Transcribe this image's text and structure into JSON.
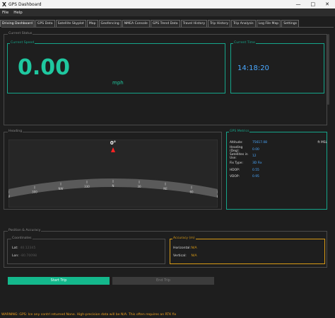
{
  "window": {
    "title": "GPS Dashboard",
    "minimize": "—",
    "maximize": "□",
    "close": "✕",
    "app_icon": "X"
  },
  "menu": {
    "items": [
      "File",
      "Help"
    ]
  },
  "tabs": [
    "Driving Dashboard",
    "GPS Data",
    "Satellite Skyplot",
    "Map",
    "Geofencing",
    "NMEA Console",
    "GPS Trend Data",
    "Travel History",
    "Trip History",
    "Trip Analysis",
    "Log File Map",
    "Settings"
  ],
  "active_tab": 0,
  "current_status": {
    "title": "Current Status",
    "speed": {
      "title": "Current Speed",
      "value": "0.00",
      "unit": "mph"
    },
    "time": {
      "title": "Current Time",
      "value": "14:18:20"
    }
  },
  "heading": {
    "title": "Heading",
    "degrees_label": "0°",
    "heading_value": 0,
    "ticks": [
      "W",
      "300",
      "NW",
      "330",
      "N",
      "30",
      "NE",
      "60",
      "E"
    ]
  },
  "gps_metrics": {
    "title": "GPS Metrics",
    "rows": [
      {
        "label": "Altitude:",
        "value": "75617.08",
        "unit": "ft MSL"
      },
      {
        "label": "Heading (Deg):",
        "value": "0.00",
        "unit": ""
      },
      {
        "label": "Satellites in Use:",
        "value": "12",
        "unit": ""
      },
      {
        "label": "Fix Type:",
        "value": "3D Fix",
        "unit": ""
      },
      {
        "label": "HDOP:",
        "value": "0.55",
        "unit": ""
      },
      {
        "label": "VDOP:",
        "value": "0.95",
        "unit": ""
      }
    ]
  },
  "position_accuracy": {
    "title": "Position & Accuracy",
    "coords": {
      "title": "Coordinates",
      "lat_label": "Lat:",
      "lat_value": "40.12345",
      "lon_label": "Lon:",
      "lon_value": "-80.70098"
    },
    "accuracy": {
      "title": "Accuracy (m)",
      "h_label": "Horizontal:",
      "h_value": "N/A",
      "v_label": "Vertical:",
      "v_value": "N/A"
    }
  },
  "buttons": {
    "start": "Start Trip",
    "end": "End Trip"
  },
  "status_bar": "WARNING: GPS: Ice any contrl returned None. High-precision data will be N/A. This often requires an RTK fix"
}
